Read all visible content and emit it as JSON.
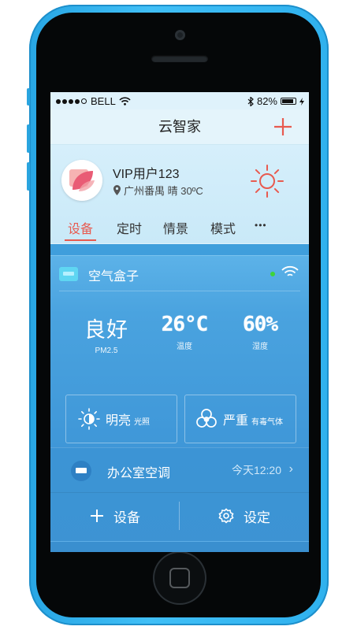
{
  "status_bar": {
    "carrier": "BELL",
    "battery_percent": "82%"
  },
  "navbar": {
    "title": "云智家"
  },
  "profile": {
    "username": "VIP用户123",
    "location": "广州番禺 晴 30ºC"
  },
  "tabs": [
    {
      "label": "设备",
      "active": true
    },
    {
      "label": "定时",
      "active": false
    },
    {
      "label": "情景",
      "active": false
    },
    {
      "label": "模式",
      "active": false
    },
    {
      "label": "•••",
      "active": false
    }
  ],
  "device_card": {
    "title": "空气盒子",
    "metrics": [
      {
        "value": "良好",
        "label": "PM2.5"
      },
      {
        "value": "26°C",
        "label": "温度"
      },
      {
        "value": "60%",
        "label": "湿度"
      }
    ],
    "tiles": [
      {
        "icon": "brightness-icon",
        "main": "明亮",
        "sub": "光照"
      },
      {
        "icon": "biohazard-icon",
        "main": "严重",
        "sub": "有毒气体"
      }
    ]
  },
  "ac_row": {
    "name": "办公室空调",
    "time": "今天12:20"
  },
  "bottom_bar": {
    "add_label": "设备",
    "settings_label": "设定"
  },
  "colors": {
    "accent": "#e85a4f",
    "phone_body": "#34b4ef",
    "card_blue": "#4aa3df"
  }
}
